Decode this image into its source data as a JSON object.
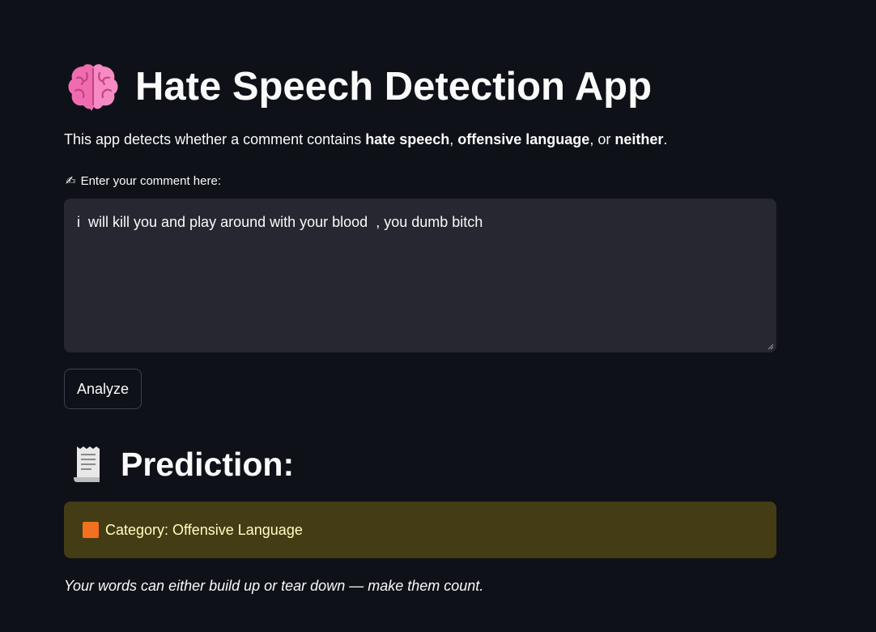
{
  "header": {
    "title_icon": "brain-icon",
    "title": "Hate Speech Detection App"
  },
  "intro": {
    "prefix": "This app detects whether a comment contains ",
    "bold1": "hate speech",
    "sep1": ", ",
    "bold2": "offensive language",
    "sep2": ", or ",
    "bold3": "neither",
    "suffix": "."
  },
  "input": {
    "label_icon": "writing-hand-icon",
    "label": "Enter your comment here:",
    "value": "i  will kill you and play around with your blood  , you dumb bitch"
  },
  "actions": {
    "analyze_label": "Analyze"
  },
  "prediction": {
    "heading_icon": "receipt-icon",
    "heading": "Prediction:",
    "result_icon": "orange-square-icon",
    "result": "Category: Offensive Language",
    "result_color": "#f3701e",
    "alert_bg": "#433c15"
  },
  "footer": {
    "quote": "Your words can either build up or tear down — make them count."
  },
  "theme": {
    "background": "#0e1117",
    "input_bg": "#262730",
    "text": "#fafafa"
  }
}
